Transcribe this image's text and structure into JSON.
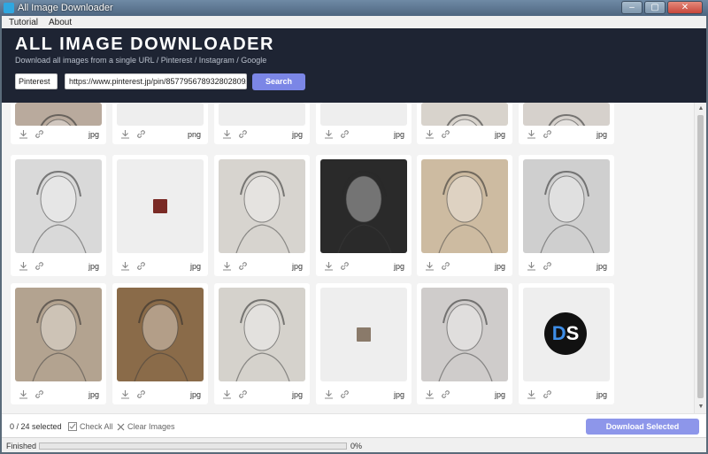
{
  "window": {
    "title": "All Image Downloader",
    "minimize": "–",
    "maximize": "▢",
    "close": "✕"
  },
  "menu": [
    {
      "label": "Tutorial"
    },
    {
      "label": "About"
    }
  ],
  "header": {
    "title": "ALL IMAGE DOWNLOADER",
    "subtitle": "Download all images from a single URL / Pinterest / Instagram / Google",
    "source": "Pinterest",
    "url": "https://www.pinterest.jp/pin/857795678932802809/",
    "search_label": "Search"
  },
  "rows": [
    {
      "partial": true,
      "cards": [
        {
          "ext": "jpg",
          "tone": "#b9aa9d",
          "icon": "sketch-photo"
        },
        {
          "ext": "png",
          "tone": "#eeeeee",
          "icon": "blank"
        },
        {
          "ext": "jpg",
          "tone": "#eeeeee",
          "icon": "blank"
        },
        {
          "ext": "jpg",
          "tone": "#eeeeee",
          "icon": "blank"
        },
        {
          "ext": "jpg",
          "tone": "#d8d3cc",
          "icon": "sketch-photo"
        },
        {
          "ext": "jpg",
          "tone": "#d6d1cc",
          "icon": "sketch-photo"
        }
      ]
    },
    {
      "partial": false,
      "cards": [
        {
          "ext": "jpg",
          "tone": "#d9d9d9",
          "icon": "sketch-photo"
        },
        {
          "ext": "jpg",
          "tone": "#eeeeee",
          "icon": "tiny-photo"
        },
        {
          "ext": "jpg",
          "tone": "#d7d4cf",
          "icon": "sketch-photo"
        },
        {
          "ext": "jpg",
          "tone": "#2a2a2a",
          "icon": "sketch-photo"
        },
        {
          "ext": "jpg",
          "tone": "#cdbba1",
          "icon": "sketch-photo"
        },
        {
          "ext": "jpg",
          "tone": "#cfcfcf",
          "icon": "sketch-photo"
        }
      ]
    },
    {
      "partial": false,
      "cards": [
        {
          "ext": "jpg",
          "tone": "#b3a390",
          "icon": "sketch-photo"
        },
        {
          "ext": "jpg",
          "tone": "#8a6b49",
          "icon": "sketch-photo"
        },
        {
          "ext": "jpg",
          "tone": "#d5d2cc",
          "icon": "sketch-photo"
        },
        {
          "ext": "jpg",
          "tone": "#eeeeee",
          "icon": "tiny-photo"
        },
        {
          "ext": "jpg",
          "tone": "#cfcccb",
          "icon": "sketch-photo"
        },
        {
          "ext": "jpg",
          "tone": "#eeeeee",
          "icon": "ds-logo",
          "logo": {
            "d": "D",
            "s": "S"
          }
        }
      ]
    }
  ],
  "footer": {
    "selected": "0 / 24 selected",
    "check_all": "Check All",
    "clear_images": "Clear Images",
    "download_selected": "Download Selected"
  },
  "status": {
    "text": "Finished",
    "progress_label": "0%",
    "progress_fraction": 0
  },
  "colors": {
    "header_bg": "#1e2433",
    "accent": "#7b86e6",
    "download_btn": "#8d96ea"
  }
}
